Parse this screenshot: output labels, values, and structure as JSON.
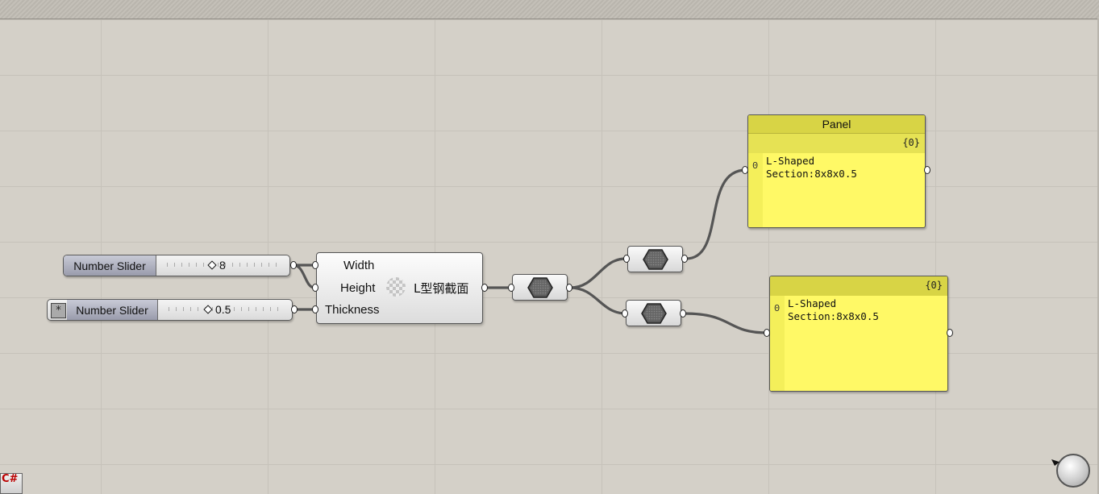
{
  "canvas": {
    "background": "#d4d0c8",
    "grid_color": "#c6c2ba"
  },
  "sliders": [
    {
      "name": "Number Slider",
      "value": "8",
      "has_star": false
    },
    {
      "name": "Number Slider",
      "value": "0.5",
      "has_star": true
    }
  ],
  "component": {
    "inputs": [
      "Width",
      "Height",
      "Thickness"
    ],
    "output": "L型钢截面"
  },
  "panels": [
    {
      "title": "Panel",
      "path": "{0}",
      "index": "0",
      "text": "L-Shaped\nSection:8x8x0.5"
    },
    {
      "title": "",
      "path": "{0}",
      "index": "0",
      "text": "L-Shaped\nSection:8x8x0.5"
    }
  ],
  "icons": {
    "csharp": "C#",
    "star": "*",
    "relay": "hexagon-relay-icon",
    "navigation": "canvas-navigation-icon"
  },
  "colors": {
    "panel_yellow": "#fff966",
    "panel_header": "#d8d445",
    "wire": "#555555"
  }
}
